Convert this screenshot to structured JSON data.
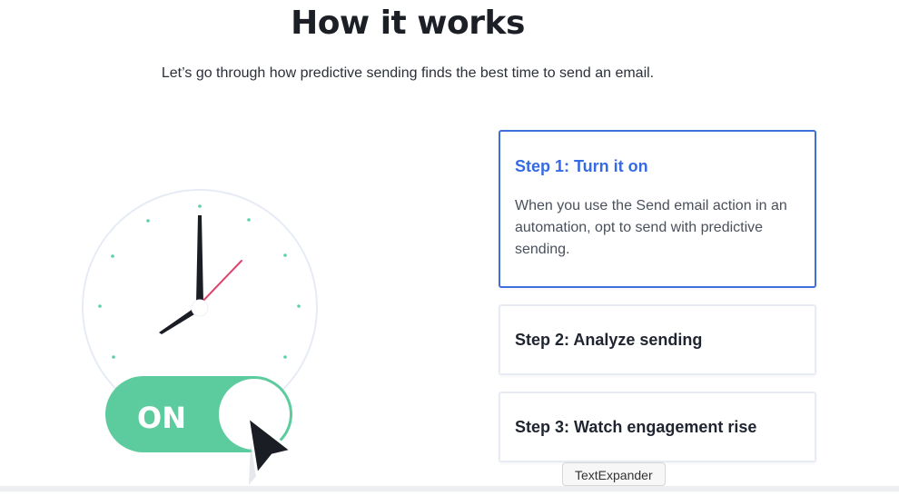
{
  "header": {
    "title": "How it works",
    "subtitle": "Let’s go through how predictive sending finds the best time to send an email."
  },
  "toggle": {
    "label": "ON"
  },
  "steps": [
    {
      "title": "Step 1: Turn it on",
      "body": "When you use the Send email action in an automation, opt to send with predictive sending.",
      "active": true
    },
    {
      "title": "Step 2: Analyze sending",
      "active": false
    },
    {
      "title": "Step 3: Watch engagement rise",
      "active": false
    }
  ],
  "tooltip": {
    "text": "TextExpander"
  },
  "colors": {
    "accent": "#356ae6",
    "toggle": "#5ccc9f",
    "clock_dots": "#5ccfae",
    "second_hand": "#e0436b"
  }
}
